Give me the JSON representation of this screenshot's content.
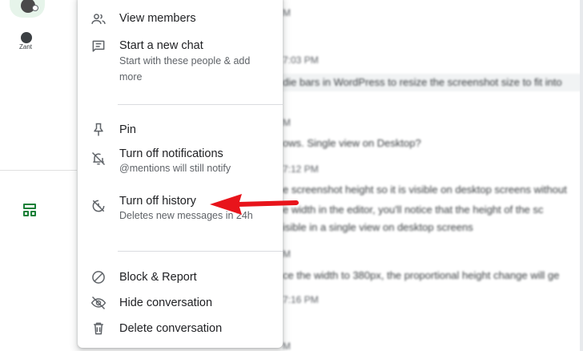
{
  "rail": {
    "contact_label": "Zant"
  },
  "chat": {
    "lines": [
      {
        "text": "M",
        "kind": "time"
      },
      {
        "text": "7:03 PM",
        "kind": "time"
      },
      {
        "text": "die bars in WordPress to resize the screenshot size to fit into",
        "kind": "msg"
      },
      {
        "text": "M",
        "kind": "time"
      },
      {
        "text": "ows. Single view on Desktop?",
        "kind": "msg"
      },
      {
        "text": "7:12 PM",
        "kind": "time"
      },
      {
        "text": "e screenshot height so it is visible on desktop screens without",
        "kind": "msg"
      },
      {
        "text": "e width in the editor, you'll notice that the height of the sc",
        "kind": "msg"
      },
      {
        "text": "isible in a single view on desktop screens",
        "kind": "msg"
      },
      {
        "text": "M",
        "kind": "time"
      },
      {
        "text": "ce the width to 380px, the proportional height change will ge",
        "kind": "msg"
      },
      {
        "text": "7:16 PM",
        "kind": "time"
      },
      {
        "text": "M",
        "kind": "time"
      }
    ]
  },
  "menu": {
    "view_members": "View members",
    "start_chat": "Start a new chat",
    "start_chat_sub": "Start with these people & add more",
    "pin": "Pin",
    "turn_off_notifications": "Turn off notifications",
    "turn_off_notifications_sub": "@mentions will still notify",
    "turn_off_history": "Turn off history",
    "turn_off_history_sub": "Deletes new messages in 24h",
    "block_report": "Block & Report",
    "hide_conversation": "Hide conversation",
    "delete_conversation": "Delete conversation"
  },
  "colors": {
    "arrow": "#e8141b",
    "accent_green": "#188038"
  }
}
